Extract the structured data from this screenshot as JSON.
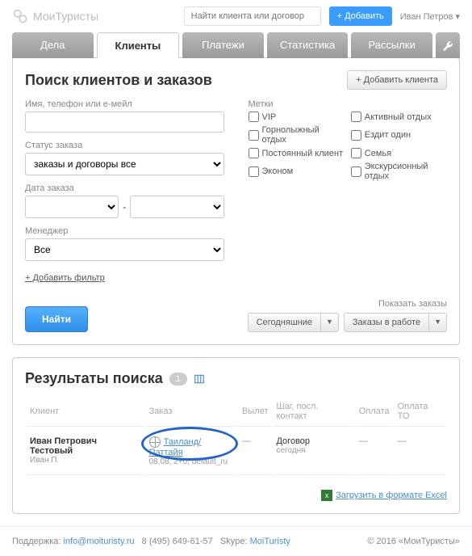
{
  "header": {
    "logo": "МоиТуристы",
    "search_placeholder": "Найти клиента или договор",
    "add_button": "+ Добавить",
    "user": "Иван Петров"
  },
  "tabs": {
    "items": [
      "Дела",
      "Клиенты",
      "Платежи",
      "Статистика",
      "Рассылки"
    ]
  },
  "search_panel": {
    "title": "Поиск клиентов и заказов",
    "add_client": "+ Добавить клиента",
    "labels": {
      "name": "Имя, телефон или е-мейл",
      "status": "Статус заказа",
      "date": "Дата заказа",
      "manager": "Менеджер",
      "tags": "Метки"
    },
    "status_value": "заказы и договоры все",
    "manager_value": "Все",
    "tags": [
      "VIP",
      "Горнолыжный отдых",
      "Постоянный клиент",
      "Эконом",
      "Активный отдых",
      "Ездит один",
      "Семья",
      "Экскурсионный отдых"
    ],
    "add_filter": "+ Добавить фильтр",
    "search_btn": "Найти",
    "quick_label": "Показать заказы",
    "quick_today": "Сегодняшние",
    "quick_inwork": "Заказы в работе"
  },
  "results": {
    "title": "Результаты поиска",
    "count": "1",
    "columns": [
      "Клиент",
      "Заказ",
      "Вылет",
      "Шаг, посл. контакт",
      "Оплата",
      "Оплата ТО"
    ],
    "row": {
      "client": "Иван Петрович Тестовый",
      "client_sub": "Иван П.",
      "order": "Таиланд/Паттайя",
      "order_sub": "08.08, 2+0, default_ru",
      "departure": "—",
      "step": "Договор",
      "step_sub": "сегодня",
      "pay": "—",
      "pay_to": "—"
    },
    "export": "Загрузить в формате Excel"
  },
  "footer": {
    "support": "Поддержка:",
    "email": "info@moituristy.ru",
    "phone": "8 (495) 649-61-57",
    "skype_label": "Skype:",
    "skype": "MoiTuristy",
    "copyright": "© 2016 «МоиТуристы»"
  }
}
